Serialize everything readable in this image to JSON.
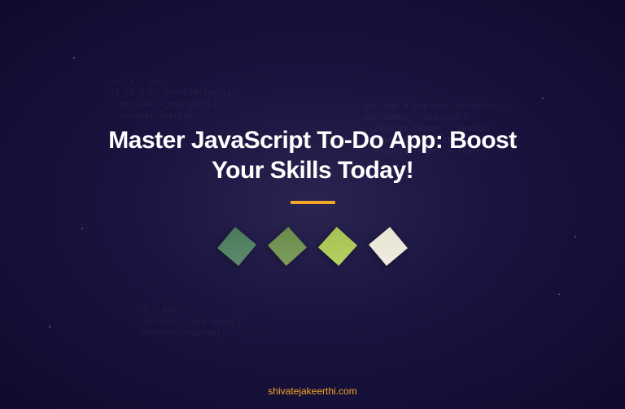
{
  "hero": {
    "title": "Master JavaScript To-Do App: Boost Your Skills Today!"
  },
  "footer": {
    "site": "shivatejakeerthi.com"
  },
  "decorative": {
    "code_snippet_1": "var x = 10;\nif (x > 5) console.log(x);\n  var now = new Date();\n  console.log(now);",
    "code_snippet_2": "var app = Express.setup(this);\nvar model = app.model;\n  exports.header = header;\n  exports.all = topic;\n  exports.footer = footer;",
    "code_snippet_3": "x = 251;\nvar now = new Date();\nconsole.log(now);"
  }
}
